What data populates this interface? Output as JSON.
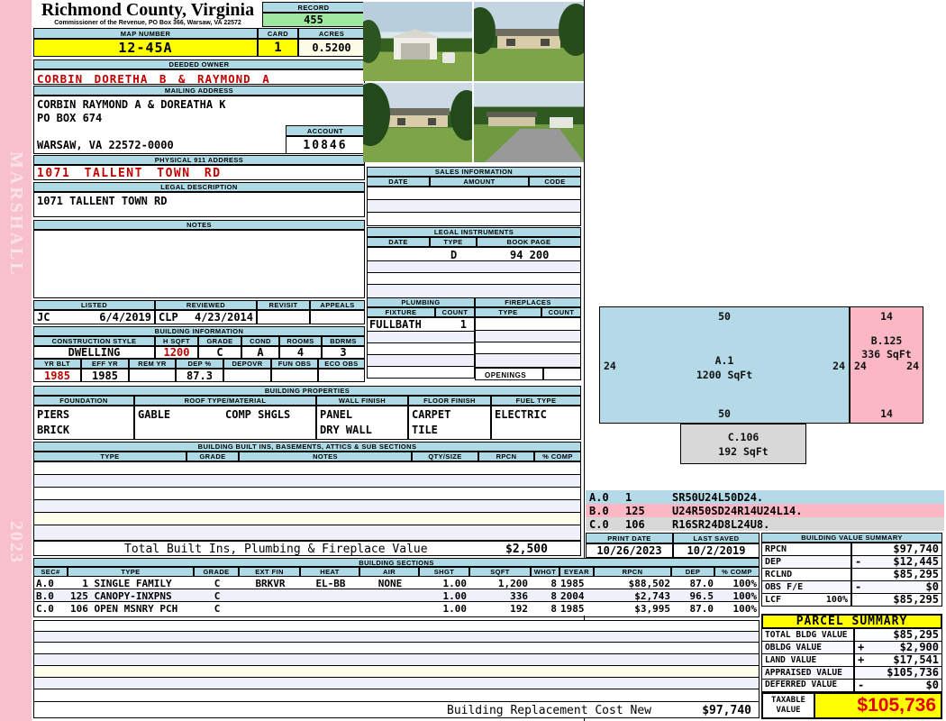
{
  "sidebar": {
    "vendor": "MARSHALL",
    "year": "2023"
  },
  "header": {
    "county": "Richmond County, Virginia",
    "commissioner": "Commissioner of the Revenue, PO Box 366, Warsaw, VA 22572",
    "record_label": "RECORD",
    "record_value": "455",
    "map_number_label": "MAP NUMBER",
    "map_number": "12-45A",
    "card_label": "CARD",
    "card_value": "1",
    "acres_label": "ACRES",
    "acres_value": "0.5200"
  },
  "owner": {
    "deeded_owner_label": "DEEDED OWNER",
    "deeded_owner": "CORBIN DORETHA B & RAYMOND A",
    "mailing_address_label": "MAILING ADDRESS",
    "mailing_line1": "CORBIN RAYMOND A & DOREATHA K",
    "mailing_line2": "PO BOX 674",
    "mailing_line3": "WARSAW, VA 22572-0000",
    "account_label": "ACCOUNT",
    "account_value": "10846",
    "physical_address_label": "PHYSICAL 911 ADDRESS",
    "physical_address": "1071 TALLENT TOWN RD",
    "legal_description_label": "LEGAL DESCRIPTION",
    "legal_description": "1071 TALLENT TOWN RD",
    "notes_label": "NOTES",
    "notes": ""
  },
  "review": {
    "listed_label": "LISTED",
    "listed_by": "JC",
    "listed_date": "6/4/2019",
    "reviewed_label": "REVIEWED",
    "reviewed_by": "CLP",
    "reviewed_date": "4/23/2014",
    "revisit_label": "REVISIT",
    "appeals_label": "APPEALS"
  },
  "building_information": {
    "title": "BUILDING INFORMATION",
    "construction_style_label": "CONSTRUCTION STYLE",
    "construction_style": "DWELLING",
    "hsqft_label": "H SQFT",
    "hsqft": "1200",
    "grade_label": "GRADE",
    "grade": "C",
    "cond_label": "COND",
    "cond": "A",
    "rooms_label": "ROOMS",
    "rooms": "4",
    "bdrms_label": "BDRMS",
    "bdrms": "3",
    "yrblt_label": "YR BLT",
    "yrblt": "1985",
    "effyr_label": "EFF YR",
    "effyr": "1985",
    "remyr_label": "REM YR",
    "remyr": "",
    "dep_label": "DEP %",
    "dep": "87.3",
    "depovr_label": "DEPOVR",
    "depovr": "",
    "funobs_label": "FUN OBS",
    "funobs": "",
    "ecoobs_label": "ECO OBS",
    "ecoobs": ""
  },
  "building_properties": {
    "title": "BUILDING PROPERTIES",
    "foundation_label": "FOUNDATION",
    "foundation1": "PIERS",
    "foundation2": "BRICK",
    "roof_label": "ROOF TYPE/MATERIAL",
    "roof_type": "GABLE",
    "roof_material": "COMP SHGLS",
    "wall_label": "WALL FINISH",
    "wall1": "PANEL",
    "wall2": "DRY WALL",
    "floor_label": "FLOOR FINISH",
    "floor1": "CARPET",
    "floor2": "TILE",
    "fuel_label": "FUEL TYPE",
    "fuel": "ELECTRIC"
  },
  "built_ins": {
    "title": "BUILDING BUILT INS, BASEMENTS, ATTICS & SUB SECTIONS",
    "headers": [
      "TYPE",
      "GRADE",
      "NOTES",
      "QTY/SIZE",
      "RPCN",
      "% COMP"
    ],
    "total_label": "Total Built Ins, Plumbing & Fireplace Value",
    "total_value": "$2,500"
  },
  "sales_information": {
    "title": "SALES INFORMATION",
    "headers": [
      "DATE",
      "AMOUNT",
      "CODE"
    ]
  },
  "legal_instruments": {
    "title": "LEGAL INSTRUMENTS",
    "headers": [
      "DATE",
      "TYPE",
      "BOOK PAGE"
    ],
    "row1_date": "",
    "row1_type": "D",
    "row1_book_page": "94 200"
  },
  "plumbing": {
    "title": "PLUMBING",
    "headers": [
      "FIXTURE",
      "COUNT"
    ],
    "row1_fixture": "FULLBATH",
    "row1_count": "1"
  },
  "fireplaces": {
    "title": "FIREPLACES",
    "headers": [
      "TYPE",
      "COUNT"
    ],
    "openings_label": "OPENINGS"
  },
  "sketch": {
    "section_a": {
      "name": "A.1",
      "sqft": "1200 SqFt",
      "dim_top": "50",
      "dim_bottom": "50",
      "dim_left": "24",
      "dim_right": "24"
    },
    "section_b": {
      "name": "B.125",
      "sqft": "336 SqFt",
      "dim_top": "14",
      "dim_bottom": "14",
      "dim_left": "24",
      "dim_right": "24"
    },
    "section_c": {
      "name": "C.106",
      "sqft": "192 SqFt"
    },
    "codes": [
      {
        "sec": "A.0",
        "num": "1",
        "vector": "SR50U24L50D24."
      },
      {
        "sec": "B.0",
        "num": "125",
        "vector": "U24R50SD24R14U24L14."
      },
      {
        "sec": "C.0",
        "num": "106",
        "vector": "R16SR24D8L24U8."
      }
    ]
  },
  "print_info": {
    "print_date_label": "PRINT DATE",
    "print_date": "10/26/2023",
    "last_saved_label": "LAST SAVED",
    "last_saved": "10/2/2019"
  },
  "building_value_summary": {
    "title": "BUILDING VALUE SUMMARY",
    "rows": [
      {
        "label": "RPCN",
        "extra": "",
        "op": "",
        "value": "$97,740"
      },
      {
        "label": "DEP",
        "extra": "",
        "op": "-",
        "value": "$12,445"
      },
      {
        "label": "RCLND",
        "extra": "",
        "op": "",
        "value": "$85,295"
      },
      {
        "label": "OBS F/E",
        "extra": "",
        "op": "-",
        "value": "$0"
      },
      {
        "label": "LCF",
        "extra": "100%",
        "op": "",
        "value": "$85,295"
      }
    ]
  },
  "building_sections": {
    "title": "BUILDING SECTIONS",
    "headers": [
      "SEC#",
      "TYPE",
      "GRADE",
      "EXT FIN",
      "HEAT",
      "AIR",
      "SHGT",
      "SQFT",
      "WHGT",
      "EYEAR",
      "RPCN",
      "DEP",
      "% COMP"
    ],
    "rows": [
      [
        "A.0",
        "  1 SINGLE FAMILY",
        "C",
        "BRKVR",
        "EL-BB",
        "NONE",
        "1.00",
        "1,200",
        "8",
        "1985",
        "$88,502",
        "87.0",
        "100%"
      ],
      [
        "B.0",
        "125 CANOPY-INXPNS",
        "C",
        "",
        "",
        "",
        "1.00",
        "336",
        "8",
        "2004",
        "$2,743",
        "96.5",
        "100%"
      ],
      [
        "C.0",
        "106 OPEN MSNRY PCH",
        "C",
        "",
        "",
        "",
        "1.00",
        "192",
        "8",
        "1985",
        "$3,995",
        "87.0",
        "100%"
      ]
    ]
  },
  "parcel_summary": {
    "title": "PARCEL SUMMARY",
    "rows": [
      {
        "label": "TOTAL BLDG VALUE",
        "op": "",
        "value": "$85,295"
      },
      {
        "label": "OBLDG VALUE",
        "op": "+",
        "value": "$2,900"
      },
      {
        "label": "LAND VALUE",
        "op": "+",
        "value": "$17,541"
      },
      {
        "label": "APPRAISED VALUE",
        "op": "",
        "value": "$105,736"
      },
      {
        "label": "DEFERRED VALUE",
        "op": "-",
        "value": "$0"
      }
    ],
    "taxable_label": "TAXABLE VALUE",
    "taxable_value": "$105,736"
  },
  "footer": {
    "label": "Building Replacement Cost New",
    "value": "$97,740"
  },
  "colors": {
    "header_bar": "#AEDAE6",
    "highlight_yellow": "#FFFF00",
    "record_green": "#9FE89F",
    "red_text": "#C00000",
    "sidebar_pink": "#F8BFCC",
    "section_a_fill": "#B4DAE7",
    "section_b_fill": "#FBB8C4",
    "section_c_fill": "#D8D8D8"
  }
}
